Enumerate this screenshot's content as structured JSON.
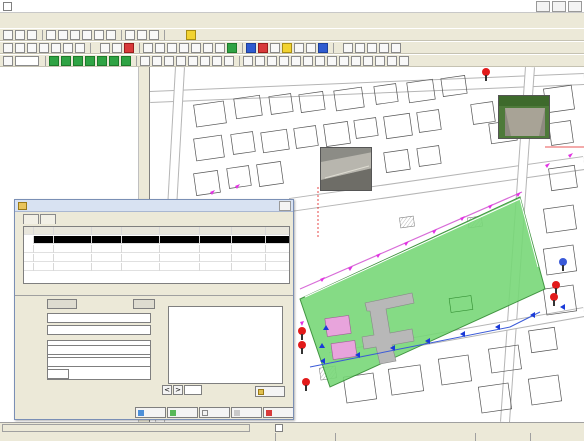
{
  "window": {
    "title": ""
  },
  "menu": [],
  "toolbar": {
    "tb1_labels": [
      "",
      "",
      ""
    ],
    "tb2_labels": [
      "",
      ""
    ]
  },
  "tree": [],
  "map": {
    "photos": [
      {
        "caption": ""
      },
      {
        "caption": ""
      }
    ],
    "parcel_color": "#78d878",
    "pin_color": "#e21b1b",
    "arrow_color": "#e233e2"
  },
  "dialog": {
    "title": "",
    "tabs": [
      "",
      ""
    ],
    "grid_header": [
      "",
      "",
      "",
      "",
      "",
      "",
      "",
      "",
      ""
    ],
    "grid_rows": [
      [
        "",
        "",
        "",
        "",
        "",
        "",
        "",
        "",
        ""
      ],
      [
        "",
        "",
        "",
        "",
        "",
        "",
        "",
        "",
        ""
      ],
      [
        "",
        "",
        "",
        "",
        "",
        "",
        "",
        "",
        ""
      ],
      [
        "",
        "",
        "",
        "",
        "",
        "",
        "",
        "",
        ""
      ]
    ],
    "pager": "",
    "fields": {
      "code_label": "",
      "code_value": "",
      "kind_label": "",
      "kind_value": "",
      "name_label": "",
      "name_value": "",
      "date_label": "",
      "date_value": "",
      "detail1_label": "",
      "detail1_value": "",
      "detail2_label": "",
      "detail2_value": "",
      "area_label": "",
      "area_value": ""
    },
    "notes_list": [],
    "thumb_nav": {
      "page": ""
    },
    "save_label": "",
    "buttons": [
      "",
      "",
      "",
      "",
      ""
    ]
  },
  "status": {
    "left_text": "",
    "cells": [
      "",
      "",
      "",
      ""
    ]
  }
}
